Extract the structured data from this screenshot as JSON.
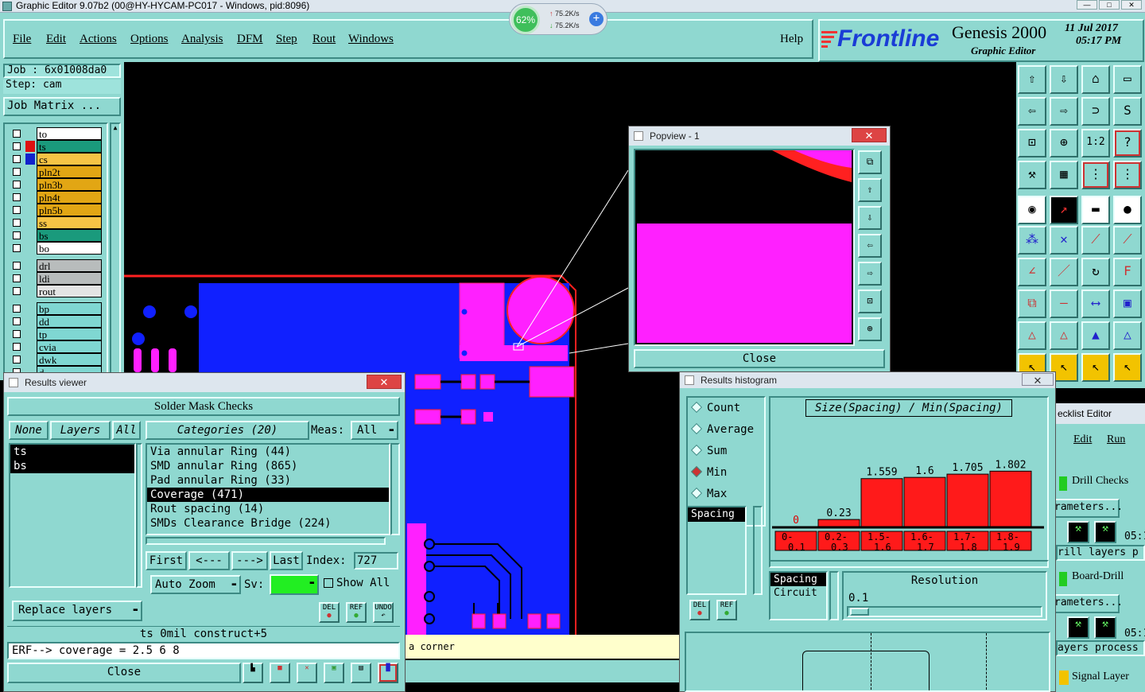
{
  "window": {
    "title": "Graphic Editor 9.07b2 (00@HY-HYCAM-PC017 - Windows, pid:8096)"
  },
  "net_widget": {
    "percent": "62%",
    "up": "75.2K/s",
    "down": "75.2K/s"
  },
  "menu": {
    "items": [
      "File",
      "Edit",
      "Actions",
      "Options",
      "Analysis",
      "DFM",
      "Step",
      "Rout",
      "Windows"
    ],
    "help": "Help"
  },
  "brand": {
    "logo": "Frontline",
    "product": "Genesis 2000",
    "subtitle": "Graphic Editor",
    "date": "11 Jul 2017",
    "time": "05:17 PM"
  },
  "job": {
    "job_line": "Job : 6x01008da0",
    "step_line": "Step: cam",
    "matrix_button": "Job Matrix ..."
  },
  "layers": [
    {
      "name": "to",
      "color": "#ffffff",
      "swatch": ""
    },
    {
      "name": "ts",
      "color": "#1a9a7c",
      "swatch": "#dd1111"
    },
    {
      "name": "cs",
      "color": "#f6c445",
      "swatch": "#1122cc"
    },
    {
      "name": "pln2t",
      "color": "#e2a614",
      "swatch": ""
    },
    {
      "name": "pln3b",
      "color": "#e2a614",
      "swatch": ""
    },
    {
      "name": "pln4t",
      "color": "#e2a614",
      "swatch": ""
    },
    {
      "name": "pln5b",
      "color": "#e2a614",
      "swatch": ""
    },
    {
      "name": "ss",
      "color": "#f6c445",
      "swatch": ""
    },
    {
      "name": "bs",
      "color": "#1a9a7c",
      "swatch": ""
    },
    {
      "name": "bo",
      "color": "#ffffff",
      "swatch": ""
    },
    {
      "name": "drl",
      "color": "#b8bcbc",
      "swatch": ""
    },
    {
      "name": "ldi",
      "color": "#b8bcbc",
      "swatch": ""
    },
    {
      "name": "rout",
      "color": "#e4e4e4",
      "swatch": ""
    },
    {
      "name": "bp",
      "color": "#7fd7d2",
      "swatch": ""
    },
    {
      "name": "dd",
      "color": "#7fd7d2",
      "swatch": ""
    },
    {
      "name": "tp",
      "color": "#7fd7d2",
      "swatch": ""
    },
    {
      "name": "cvia",
      "color": "#7fd7d2",
      "swatch": ""
    },
    {
      "name": "dwk",
      "color": "#7fd7d2",
      "swatch": ""
    },
    {
      "name": "d",
      "color": "#7fd7d2",
      "swatch": ""
    }
  ],
  "popview": {
    "title": "Popview - 1",
    "close": "Close"
  },
  "results": {
    "title": "Results viewer",
    "header": "Solder Mask Checks",
    "filters": {
      "none": "None",
      "layers": "Layers",
      "all": "All"
    },
    "categories_label": "Categories (20)",
    "meas_label": "Meas:",
    "meas_value": "All",
    "layer_list": [
      "ts",
      "bs"
    ],
    "categories": [
      "Via annular Ring (44)",
      "SMD annular Ring (865)",
      "Pad annular Ring (33)",
      "Coverage (471)",
      "Rout spacing (14)",
      "SMDs Clearance Bridge (224)"
    ],
    "nav": {
      "first": "First",
      "prev": "<---",
      "next": "--->",
      "last": "Last",
      "index_label": "Index:",
      "index_value": "727"
    },
    "auto_zoom": "Auto Zoom",
    "sv_label": "Sv:",
    "show_all": "Show All",
    "replace_layers": "Replace layers",
    "small_btns": [
      "DEL",
      "REF",
      "UNDO"
    ],
    "status1": "ts 0mil  construct+5",
    "status2": "ERF--> coverage = 2.5 6 8",
    "close": "Close"
  },
  "message": "a corner",
  "histogram": {
    "title": "Results histogram",
    "stats": [
      "Count",
      "Average",
      "Sum",
      "Min",
      "Max"
    ],
    "selected_stat": "Min",
    "chart_title": "Size(Spacing) / Min(Spacing)",
    "list": [
      "Spacing"
    ],
    "small_btns": [
      "DEL",
      "REF"
    ],
    "bottom_list": [
      "Spacing",
      "Circuit"
    ],
    "resolution_label": "Resolution",
    "resolution_value": "0.1"
  },
  "chart_data": {
    "type": "bar",
    "title": "Size(Spacing) / Min(Spacing)",
    "categories": [
      "0-0.1",
      "0.2-0.3",
      "1.5-1.6",
      "1.6-1.7",
      "1.7-1.8",
      "1.8-1.9"
    ],
    "values": [
      0,
      0.23,
      1.559,
      1.6,
      1.705,
      1.802
    ],
    "labels": [
      "0",
      "0.23",
      "1.559",
      "1.6",
      "1.705",
      "1.802"
    ],
    "ylim": [
      0,
      1.9
    ],
    "bar_color": "#ff1a1a"
  },
  "checklist": {
    "title": "ecklist Editor",
    "menu": [
      "Edit",
      "Run"
    ],
    "items": [
      {
        "label": "Drill Checks",
        "sub": "rameters...",
        "time": "05:1",
        "layers": "rill layers p"
      },
      {
        "label": "Board-Drill",
        "sub": "rameters...",
        "time": "05:1",
        "layers": "ayers process"
      },
      {
        "label": "Signal Layer",
        "sub": "",
        "time": "",
        "layers": ""
      }
    ]
  }
}
